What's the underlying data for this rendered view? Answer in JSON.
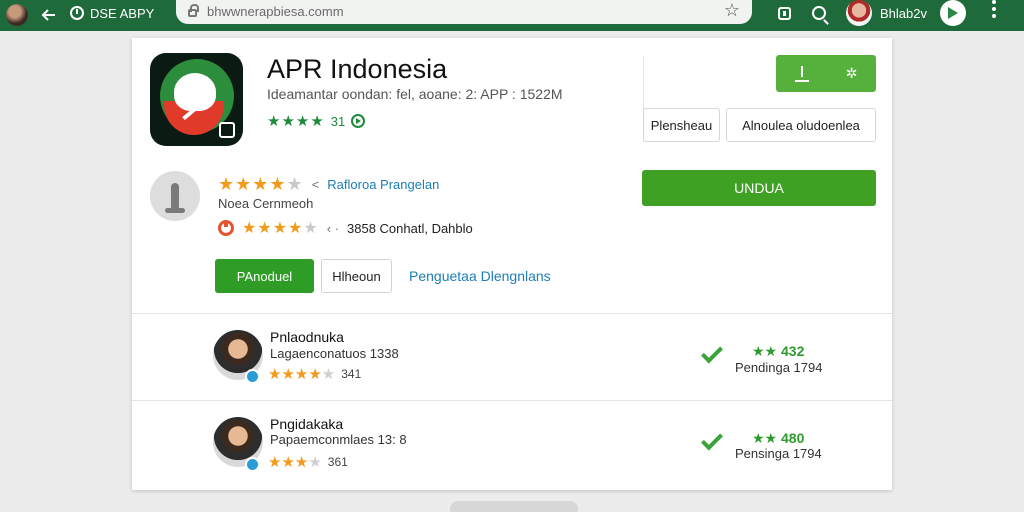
{
  "browser": {
    "tab_title": "DSE ABPY",
    "url": "bhwwnerapbiesa.comm",
    "profile_name": "Bhlab2v"
  },
  "app": {
    "title": "APR Indonesia",
    "subtitle": "Ideamantar oondan: fel, aoane: 2: APP : 1522M",
    "rating_count": "31",
    "stars": "★★★★"
  },
  "actions": {
    "install_label": "",
    "btn_left": "Plensheau",
    "btn_right": "Alnoulea oludoenlea",
    "update_label": "UNDUA"
  },
  "review": {
    "stars": "★★★★",
    "link_text": "Rafloroa Prangelan",
    "meta_text": "Noea Cernmeoh",
    "second_stars": "★★★★",
    "second_meta": "3858 Conhatl, Dahblo"
  },
  "buttons": {
    "primary": "PAnoduel",
    "secondary": "Hlheoun",
    "link": "Penguetaa Dlengnlans"
  },
  "reviews": [
    {
      "name": "Pnlaodnuka",
      "line": "Lagaenconatuos 1338",
      "stars": "★★★★",
      "count": "341",
      "score": "★★ 432",
      "sub": "Pendinga 1794"
    },
    {
      "name": "Pngidakaka",
      "line": "Papaemconmlaes 13: 8",
      "stars": "★★★",
      "count": "361",
      "score": "★★ 480",
      "sub": "Pensinga 1794"
    }
  ],
  "colors": {
    "toolbar": "#1f6a3a",
    "accent_green": "#3ea124",
    "link_blue": "#1a7fb8",
    "star_orange": "#f29a1c"
  }
}
